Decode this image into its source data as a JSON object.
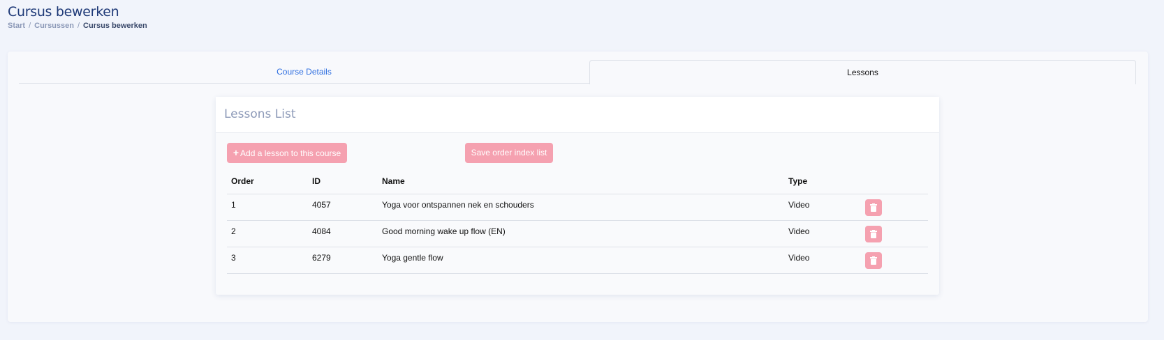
{
  "header": {
    "title": "Cursus bewerken",
    "breadcrumb": [
      "Start",
      "Cursussen",
      "Cursus bewerken"
    ]
  },
  "tabs": [
    {
      "label": "Course Details",
      "active": false
    },
    {
      "label": "Lessons",
      "active": true
    }
  ],
  "lessons_card": {
    "title": "Lessons List",
    "add_button_label": "Add a lesson to this course",
    "save_button_label": "Save order index list",
    "columns": [
      "Order",
      "ID",
      "Name",
      "Type",
      ""
    ],
    "rows": [
      {
        "order": "1",
        "id": "4057",
        "name": "Yoga voor ontspannen nek en schouders",
        "type": "Video"
      },
      {
        "order": "2",
        "id": "4084",
        "name": "Good morning wake up flow (EN)",
        "type": "Video"
      },
      {
        "order": "3",
        "id": "6279",
        "name": "Yoga gentle flow",
        "type": "Video"
      }
    ]
  },
  "icons": {
    "add": "plus-icon",
    "delete": "trash-icon"
  },
  "colors": {
    "title": "#1f3a78",
    "link": "#2f6fe0",
    "button": "#f5a1b0",
    "muted": "#8d9ab8",
    "background": "#f1f4fb"
  }
}
